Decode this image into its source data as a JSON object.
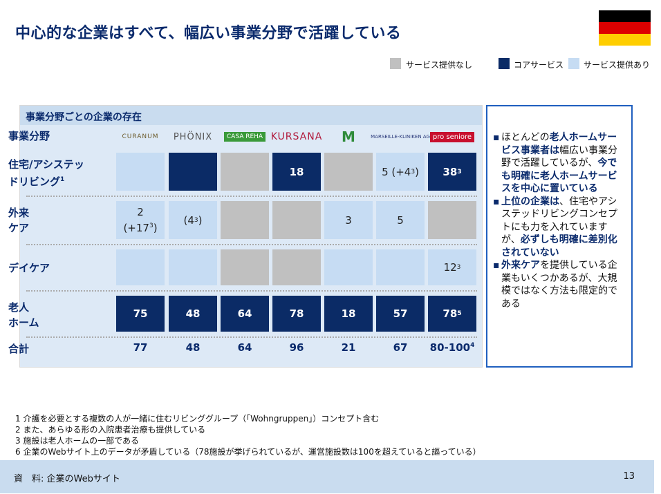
{
  "title": "中心的な企業はすべて、幅広い事業分野で活躍している",
  "legend": {
    "none": "サービス提供なし",
    "core": "コアサービス",
    "avail": "サービス提供あり"
  },
  "panel_title": "事業分野ごとの企業の存在",
  "header_label": "事業分野",
  "companies": [
    "CURANUM",
    "PHÖNIX",
    "CASA REHA",
    "KURSANA",
    "M",
    "MARSEILLE-KLINIKEN AG",
    "pro seniore"
  ],
  "rows": [
    {
      "label_line1": "住宅/アシステッ",
      "label_line2": "ドリビング",
      "label_sup": "1",
      "cells": [
        {
          "type": "avail",
          "text": ""
        },
        {
          "type": "core",
          "text": ""
        },
        {
          "type": "none",
          "text": ""
        },
        {
          "type": "core",
          "text": "18"
        },
        {
          "type": "none",
          "text": ""
        },
        {
          "type": "avail",
          "text": "5 (+4",
          "sup": "3",
          "tail": ")"
        },
        {
          "type": "core",
          "text": "38",
          "sup": "3"
        }
      ]
    },
    {
      "label_line1": "外来",
      "label_line2": "ケア",
      "label_sup": "",
      "cells": [
        {
          "type": "avail",
          "text": "2",
          "text2": "(+17",
          "sup": "3",
          "tail": ")"
        },
        {
          "type": "avail",
          "text": "(4",
          "sup": "3",
          "tail": ")"
        },
        {
          "type": "none",
          "text": ""
        },
        {
          "type": "none",
          "text": ""
        },
        {
          "type": "avail",
          "text": "3"
        },
        {
          "type": "avail",
          "text": "5"
        },
        {
          "type": "none",
          "text": ""
        }
      ]
    },
    {
      "label_line1": "デイケア",
      "label_line2": "",
      "label_sup": "",
      "cells": [
        {
          "type": "avail",
          "text": ""
        },
        {
          "type": "avail",
          "text": ""
        },
        {
          "type": "none",
          "text": ""
        },
        {
          "type": "none",
          "text": ""
        },
        {
          "type": "avail",
          "text": ""
        },
        {
          "type": "avail",
          "text": ""
        },
        {
          "type": "avail",
          "text": "12",
          "sup": "3"
        }
      ]
    },
    {
      "label_line1": "老人",
      "label_line2": "ホーム",
      "label_sup": "",
      "cells": [
        {
          "type": "core",
          "text": "75"
        },
        {
          "type": "core",
          "text": "48"
        },
        {
          "type": "core",
          "text": "64"
        },
        {
          "type": "core",
          "text": "78"
        },
        {
          "type": "core",
          "text": "18"
        },
        {
          "type": "core",
          "text": "57"
        },
        {
          "type": "core",
          "text": "78",
          "sup": "5"
        }
      ]
    }
  ],
  "totals_label": "合計",
  "totals": [
    {
      "text": "77"
    },
    {
      "text": "48"
    },
    {
      "text": "64"
    },
    {
      "text": "96"
    },
    {
      "text": "21"
    },
    {
      "text": "67"
    },
    {
      "text": "80-100",
      "sup": "4"
    }
  ],
  "side": {
    "b1_pre": "ほとんどの",
    "b1_hl1": "老人ホームサービス事業者は",
    "b1_mid": "幅広い事業分野で活躍しているが、",
    "b1_hl2": "今でも明確に老人ホームサービスを中心に置いている",
    "b2_hl1": "上位の企業は",
    "b2_mid": "、住宅やアシステッドリビングコンセプトにも力を入れていますが、",
    "b2_hl2": "必ずしも明確に差別化されていない",
    "b3_hl1": "外来ケア",
    "b3_mid": "を提供している企業もいくつかあるが、大規模ではなく方法も限定的である"
  },
  "notes": [
    "1 介護を必要とする複数の人が一緒に住むリビンググループ（「Wohngruppen」）コンセプト含む",
    "2 また、あらゆる形の入院患者治療も提供している",
    "3 施設は老人ホームの一部である",
    "6 企業のWebサイト上のデータが矛盾している（78施設が挙げられているが、運営施設数は100を超えていると謳っている）"
  ],
  "footer": {
    "source": "資　料: 企業のWebサイト",
    "page": "13"
  },
  "colors": {
    "core": "#0b2b66",
    "avail": "#c6dcf3",
    "none": "#c0c0c0",
    "title": "#0a2a6c"
  }
}
